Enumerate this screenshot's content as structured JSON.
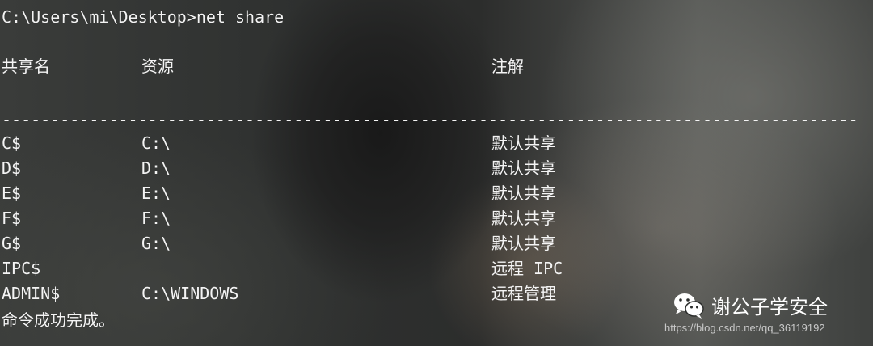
{
  "prompt": "C:\\Users\\mi\\Desktop>net share",
  "headers": {
    "share_name": "共享名",
    "resource": "资源",
    "remark": "注解"
  },
  "separator": "-------------------------------------------------------------------------------------------------------------",
  "rows": [
    {
      "name": "C$",
      "resource": "C:\\",
      "remark": "默认共享"
    },
    {
      "name": "D$",
      "resource": "D:\\",
      "remark": "默认共享"
    },
    {
      "name": "E$",
      "resource": "E:\\",
      "remark": "默认共享"
    },
    {
      "name": "F$",
      "resource": "F:\\",
      "remark": "默认共享"
    },
    {
      "name": "G$",
      "resource": "G:\\",
      "remark": "默认共享"
    },
    {
      "name": "IPC$",
      "resource": "",
      "remark": "远程 IPC"
    },
    {
      "name": "ADMIN$",
      "resource": "C:\\WINDOWS",
      "remark": "远程管理"
    }
  ],
  "completion": "命令成功完成。",
  "watermark": {
    "icon": "wechat-icon",
    "text": "谢公子学安全",
    "url": "https://blog.csdn.net/qq_36119192"
  }
}
